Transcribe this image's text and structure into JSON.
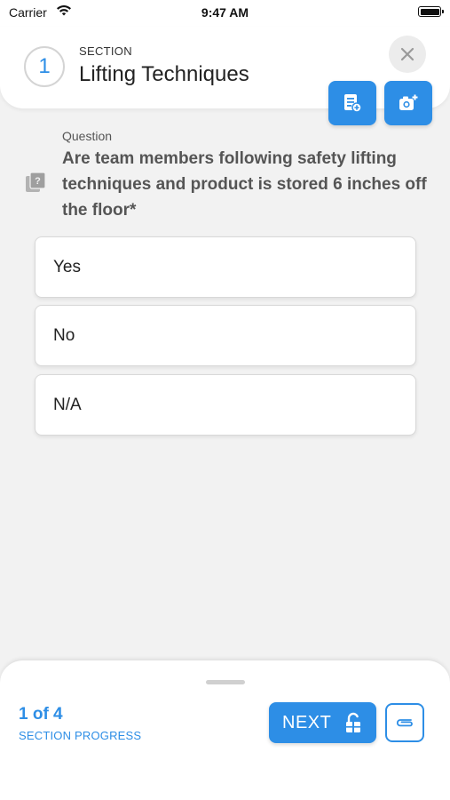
{
  "status_bar": {
    "carrier": "Carrier",
    "time": "9:47 AM"
  },
  "header": {
    "section_number": "1",
    "section_caption": "SECTION",
    "section_title": "Lifting Techniques"
  },
  "question": {
    "caption": "Question",
    "text": "Are team members  following safety lifting techniques and product is stored 6 inches off the floor*"
  },
  "options": [
    {
      "label": "Yes"
    },
    {
      "label": "No"
    },
    {
      "label": "N/A"
    }
  ],
  "footer": {
    "progress_count": "1 of 4",
    "progress_label": "SECTION PROGRESS",
    "next_label": "NEXT"
  },
  "colors": {
    "accent": "#2d8ee6",
    "background": "#f2f2f2",
    "text_muted": "#555555"
  },
  "icons": [
    "wifi-icon",
    "battery-icon",
    "close-icon",
    "add-note-icon",
    "add-photo-icon",
    "question-icon",
    "unlock-icon",
    "paperclip-icon"
  ]
}
